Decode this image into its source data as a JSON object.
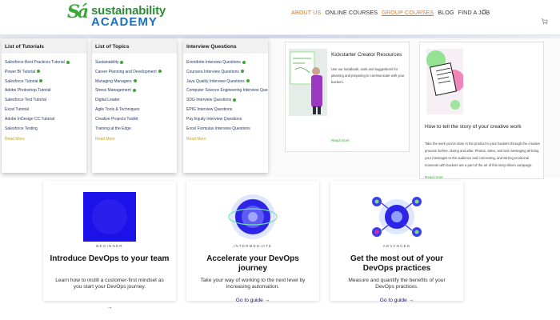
{
  "brand": {
    "mark": "Sá",
    "line1": "sustainability",
    "line2": "ACADEMY",
    "colors": {
      "green": "#3aa635",
      "blue": "#1c6fb8",
      "orange": "#e8751a"
    }
  },
  "nav": {
    "items": [
      {
        "label": "ABOUT US",
        "style": "orange"
      },
      {
        "label": "ONLINE COURSES",
        "style": "normal"
      },
      {
        "label": "GROUP COURSES",
        "style": "active"
      },
      {
        "label": "BLOG",
        "style": "normal"
      },
      {
        "label": "FIND A JOB",
        "style": "normal"
      }
    ],
    "icons": [
      "search-icon",
      "cart-icon"
    ]
  },
  "menu": {
    "columns": [
      {
        "heading": "List of Tutorials",
        "items": [
          "Salesforce Best Practices Tutorial",
          "Power BI Tutorial",
          "Salesforce Tutorial",
          "Adobe Photoshop Tutorial",
          "Salesforce Test Tutorial",
          "Excel Tutorial",
          "Adobe InDesign CC Tutorial",
          "Salesforce Testing"
        ],
        "flagged": [
          true,
          true,
          true,
          false,
          false,
          false,
          false,
          false
        ],
        "more": "Read More"
      },
      {
        "heading": "List of Topics",
        "items": [
          "Sustainability",
          "Career Planning and Development",
          "Managing Managers",
          "Stress Management",
          "Digital Leader",
          "Agile Tools & Techniques",
          "Creative Projects Toolkit",
          "Training at the Edge"
        ],
        "flagged": [
          true,
          true,
          true,
          true,
          false,
          false,
          false,
          false
        ],
        "more": "Read More"
      },
      {
        "heading": "Interview Questions",
        "items": [
          "Eventbrite Interview Questions",
          "Coursera Interview Questions",
          "Java Quality Interview Questions",
          "Computer Science Engineering Interview Questions",
          "SDG Interview Questions",
          "EPIG Interview Questions",
          "Pay Equity Interview Questions",
          "Excel Formulas Interview Questions"
        ],
        "flagged": [
          true,
          true,
          true,
          true,
          true,
          false,
          false,
          false
        ],
        "more": "Read More"
      }
    ],
    "resources": [
      {
        "title": "Kickstarter Creator Resources",
        "desc": "Use our handbook, tools and suggestions for planning and preparing to communicate with your backers.",
        "link": "Read more"
      },
      {
        "title": "How to tell the story of your creative work",
        "desc": "Take the work you've done in the product to your backers through the creative process: before, during and after. Photos, video, and text messaging all bring your messages to the audience and connecting, and stirring emotional moments with backers are a part of the art of this story-driven campaign.",
        "link": "Read more"
      }
    ]
  },
  "guides": [
    {
      "level": "BEGINNER",
      "title": "Introduce DevOps to your team",
      "desc": "Learn how to instill a customer-first mindset as you start your DevOps journey.",
      "link": "→",
      "art_color": "#1a12e8"
    },
    {
      "level": "INTERMEDIATE",
      "title": "Accelerate your DevOps journey",
      "desc": "Take your way of working to the next level by increasing automation.",
      "link": "Go to guide →",
      "art_color": "#3a3df0"
    },
    {
      "level": "ADVANCED",
      "title": "Get the most out of your DevOps practices",
      "desc": "Measure and quantify the benefits of your DevOps practices.",
      "link": "Go to guide →",
      "art_color": "#3a3df0"
    }
  ]
}
